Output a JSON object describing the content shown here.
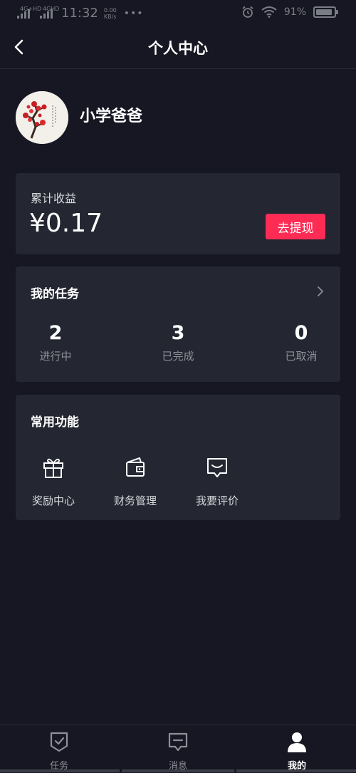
{
  "status_bar": {
    "signal1": "4G+HD",
    "signal2": "4GHD",
    "time": "11:32",
    "speed_value": "0.00",
    "speed_unit": "KB/s",
    "dots": "•••",
    "battery": "91%",
    "battery_level": 0.91
  },
  "nav": {
    "title": "个人中心"
  },
  "profile": {
    "username": "小学爸爸"
  },
  "earnings": {
    "label": "累计收益",
    "value": "¥0.17",
    "withdraw_label": "去提现"
  },
  "tasks": {
    "title": "我的任务",
    "stats": [
      {
        "value": "2",
        "label": "进行中"
      },
      {
        "value": "3",
        "label": "已完成"
      },
      {
        "value": "0",
        "label": "已取消"
      }
    ]
  },
  "functions": {
    "title": "常用功能",
    "items": [
      {
        "label": "奖励中心",
        "icon": "gift-icon"
      },
      {
        "label": "财务管理",
        "icon": "wallet-icon"
      },
      {
        "label": "我要评价",
        "icon": "comment-icon"
      }
    ]
  },
  "tabbar": {
    "items": [
      {
        "label": "任务",
        "icon": "task-shield-icon"
      },
      {
        "label": "消息",
        "icon": "message-icon"
      },
      {
        "label": "我的",
        "icon": "user-icon",
        "active": true
      }
    ]
  },
  "colors": {
    "background": "#161722",
    "card": "#242631",
    "accent": "#fe2c55",
    "muted_text": "#8e9099"
  }
}
